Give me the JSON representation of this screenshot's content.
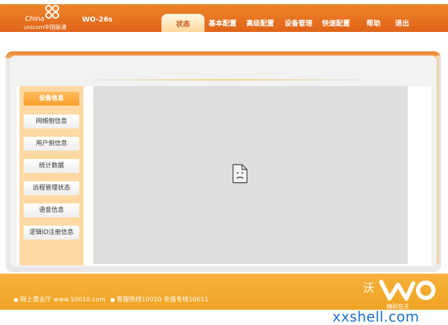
{
  "brand": {
    "logo_en_1": "China",
    "logo_en_2": "unicom中国联通",
    "model": "WO-26s"
  },
  "nav": {
    "active": "状态",
    "items": [
      "基本配置",
      "高级配置",
      "设备管理",
      "快速配置",
      "帮助",
      "退出"
    ]
  },
  "sidebar": {
    "items": [
      {
        "label": "设备信息",
        "active": true
      },
      {
        "label": "网络侧信息",
        "active": false
      },
      {
        "label": "用户侧信息",
        "active": false
      },
      {
        "label": "统计数据",
        "active": false
      },
      {
        "label": "远程管理状态",
        "active": false
      },
      {
        "label": "语音信息",
        "active": false
      },
      {
        "label": "逻辑ID注册信息",
        "active": false
      }
    ]
  },
  "viewer": {
    "state_icon": "broken-page-icon"
  },
  "footer": {
    "item1": "网上营业厅  www.10010.com",
    "item2": "客服热线10010  充值专线10011",
    "wo_text": "沃",
    "wo_sub": "精彩在沃"
  },
  "watermark": "xxshell.com",
  "colors": {
    "accent_orange": "#e0641a",
    "footer_gold": "#f5b23d",
    "sidebar_bg": "#ffd9a3",
    "active_menu": "#f7a02c"
  }
}
